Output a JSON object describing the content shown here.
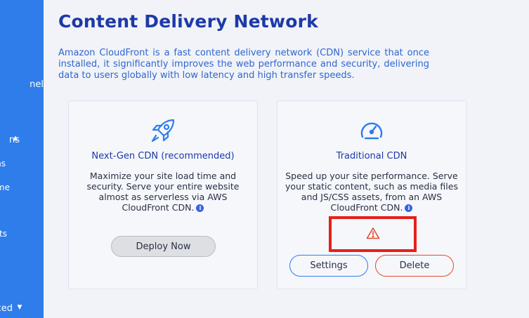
{
  "sidebar": {
    "items": [
      {
        "label": "nel"
      },
      {
        "label": "ns",
        "caret": "▲"
      },
      {
        "label": "ns"
      },
      {
        "label": "me"
      },
      {
        "label": "ts"
      },
      {
        "label": "ced",
        "caret": "▼"
      }
    ]
  },
  "page": {
    "title": "Content Delivery Network",
    "description": "Amazon CloudFront is a fast content delivery network (CDN) service that once installed, it significantly improves the web performance and security, delivering data to users globally with low latency and high transfer speeds."
  },
  "cards": [
    {
      "icon": "rocket-icon",
      "title": "Next-Gen CDN (recommended)",
      "text": "Maximize your site load time and security. Serve your entire website almost as serverless via AWS CloudFront CDN.",
      "button": "Deploy Now"
    },
    {
      "icon": "speedometer-icon",
      "title": "Traditional CDN",
      "text": "Speed up your site performance. Serve your static content, such as media files and JS/CSS assets, from an AWS CloudFront CDN.",
      "status_icon": "warning-icon",
      "settings_button": "Settings",
      "delete_button": "Delete"
    }
  ],
  "colors": {
    "sidebar": "#2f7dea",
    "title": "#1d39a8",
    "accent": "#2f7dea",
    "danger": "#e5201b",
    "warning": "#e24b2e"
  }
}
